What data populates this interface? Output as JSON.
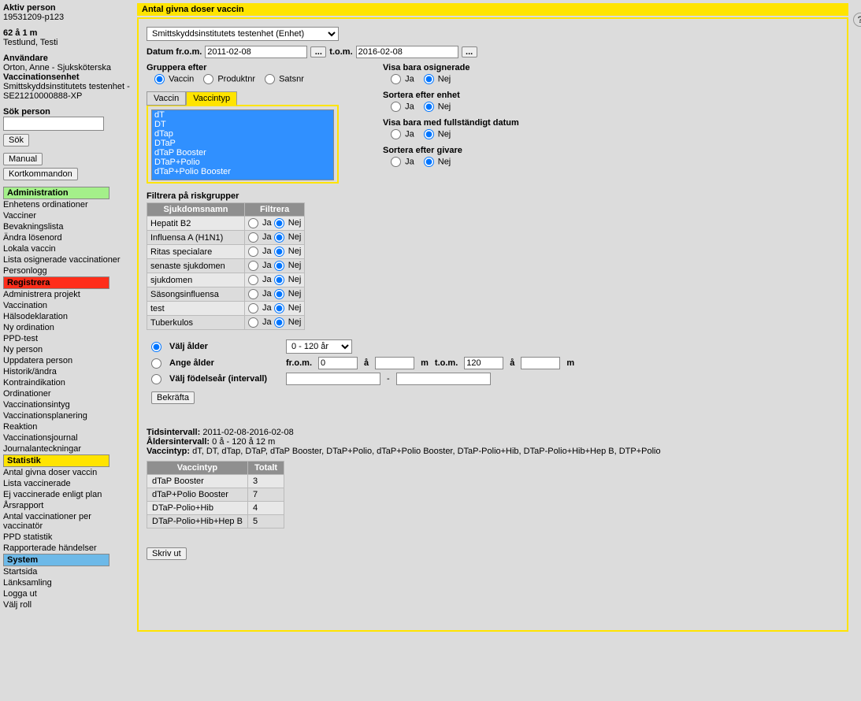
{
  "sidebar": {
    "active_person_label": "Aktiv person",
    "active_person": "19531209-p123",
    "age_row": "62 å 1 m",
    "name": "Testlund, Testi",
    "user_label": "Användare",
    "user": "Orton, Anne - Sjuksköterska",
    "vaccunit_label": "Vaccinationsenhet",
    "vaccunit": "Smittskyddsinstitutets testenhet - SE21210000888-XP",
    "search_label": "Sök person",
    "search_btn": "Sök",
    "manual_btn": "Manual",
    "kort_btn": "Kortkommandon",
    "sections": {
      "admin": {
        "title": "Administration",
        "items": [
          "Enhetens ordinationer",
          "Vacciner",
          "Bevakningslista",
          "Ändra lösenord",
          "Lokala vaccin",
          "Lista osignerade vaccinationer",
          "Personlogg"
        ]
      },
      "reg": {
        "title": "Registrera",
        "items": [
          "Administrera projekt",
          "Vaccination",
          "Hälsodeklaration",
          "Ny ordination",
          "PPD-test",
          "Ny person",
          "Uppdatera person",
          "Historik/ändra",
          "Kontraindikation",
          "Ordinationer",
          "Vaccinationsintyg",
          "Vaccinationsplanering",
          "Reaktion",
          "Vaccinationsjournal",
          "Journalanteckningar"
        ]
      },
      "stat": {
        "title": "Statistik",
        "items": [
          "Antal givna doser vaccin",
          "Lista vaccinerade",
          "Ej vaccinerade enligt plan",
          "Årsrapport",
          "Antal vaccinationer per vaccinatör",
          "PPD statistik",
          "Rapporterade händelser"
        ]
      },
      "sys": {
        "title": "System",
        "items": [
          "Startsida",
          "Länksamling",
          "Logga ut",
          "Välj roll"
        ]
      }
    }
  },
  "main": {
    "title": "Antal givna doser vaccin",
    "unit_selected": "Smittskyddsinstitutets testenhet (Enhet)",
    "date_from_label": "Datum fr.o.m.",
    "date_from": "2011-02-08",
    "date_to_label": "t.o.m.",
    "date_to": "2016-02-08",
    "group_label": "Gruppera efter",
    "group_options": {
      "vaccin": "Vaccin",
      "produktnr": "Produktnr",
      "satsnr": "Satsnr"
    },
    "unsign_label": "Visa bara osignerade",
    "sort_unit_label": "Sortera efter enhet",
    "full_date_label": "Visa bara med fullständigt datum",
    "sort_giver_label": "Sortera efter givare",
    "ja": "Ja",
    "nej": "Nej",
    "tab_vaccin": "Vaccin",
    "tab_vaccintyp": "Vaccintyp",
    "list_items": [
      "dT",
      "DT",
      "dTap",
      "DTaP",
      "dTaP Booster",
      "DTaP+Polio",
      "dTaP+Polio Booster"
    ],
    "risk_label": "Filtrera på riskgrupper",
    "risk_col1": "Sjukdomsnamn",
    "risk_col2": "Filtrera",
    "risk_rows": [
      "Hepatit B2",
      "Influensa A (H1N1)",
      "Ritas specialare",
      "senaste sjukdomen",
      "sjukdomen",
      "Säsongsinfluensa",
      "test",
      "Tuberkulos"
    ],
    "age_valj": "Välj ålder",
    "age_range_selected": "0 - 120 år",
    "age_ange": "Ange ålder",
    "from": "fr.o.m.",
    "to": "t.o.m.",
    "from_val": "0",
    "to_val": "120",
    "year_a": "å",
    "month_m": "m",
    "age_birth": "Välj födelseår (intervall)",
    "confirm": "Bekräfta",
    "tids_label": "Tidsintervall:",
    "tids_val": "2011-02-08-2016-02-08",
    "ald_label": "Åldersintervall:",
    "ald_val": "0 å - 120 å 12 m",
    "vactyp_label": "Vaccintyp:",
    "vactyp_val": "dT, DT, dTap, DTaP, dTaP Booster, DTaP+Polio, dTaP+Polio Booster, DTaP-Polio+Hib, DTaP-Polio+Hib+Hep B, DTP+Polio",
    "result_col1": "Vaccintyp",
    "result_col2": "Totalt",
    "result_rows": [
      {
        "name": "dTaP Booster",
        "total": "3"
      },
      {
        "name": "dTaP+Polio Booster",
        "total": "7"
      },
      {
        "name": "DTaP-Polio+Hib",
        "total": "4"
      },
      {
        "name": "DTaP-Polio+Hib+Hep B",
        "total": "5"
      }
    ],
    "print": "Skriv ut"
  }
}
